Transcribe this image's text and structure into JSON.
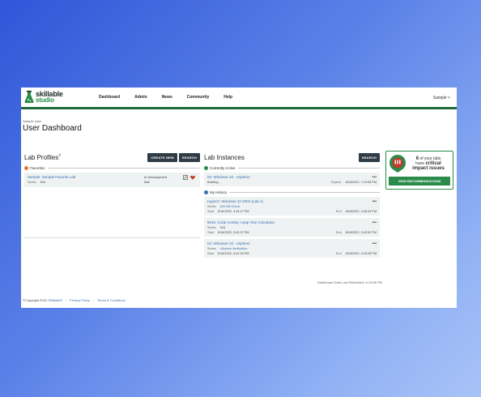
{
  "logo": {
    "line1": "skillable",
    "line2": "studio"
  },
  "nav": [
    "Dashboard",
    "Admin",
    "News",
    "Community",
    "Help"
  ],
  "user_menu": "Sample ˅",
  "header": {
    "sub": "Sample User",
    "title": "User Dashboard"
  },
  "lab_profiles": {
    "title": "Lab Profiles",
    "help": "?",
    "create_label": "CREATE NEW",
    "search_label": "SEARCH",
    "favorites_label": "Favorites",
    "favorites": [
      {
        "name": "Sample: Sample Favorite Lab",
        "series_key": "Series",
        "series_val": "N/A",
        "status": "In Development",
        "status2": "N/A"
      }
    ]
  },
  "lab_instances": {
    "title": "Lab Instances",
    "search_label": "SEARCH",
    "active_label": "Currently Active",
    "active": [
      {
        "name": "02: Windows 10 - vSphere",
        "status": "Building...",
        "expires_key": "Expires",
        "expires_val": "8/18/2022, 7:13:53 PM"
      }
    ],
    "history_label": "My History",
    "history": [
      {
        "name": "HyperV: Windows 10 2004 (Lab A)",
        "series_key": "Series",
        "series_val": "A/B Diff Check",
        "start_key": "Start",
        "start_val": "8/18/2022, 3:44:47 PM",
        "end_key": "End",
        "end_val": "8/18/2022, 4:45:44 PM"
      },
      {
        "name": "9042: Code Activity- Leap Year Calculator",
        "series_key": "Series",
        "series_val": "N/A",
        "start_key": "Start",
        "start_val": "8/18/2022, 3:42:37 PM",
        "end_key": "End",
        "end_val": "8/18/2022, 3:42:52 PM"
      },
      {
        "name": "02: Windows 10 - vSphere",
        "series_key": "Series",
        "series_val": "vSphere Verification",
        "start_key": "Start",
        "start_val": "8/18/2022, 3:41:30 PM",
        "end_key": "End",
        "end_val": "8/18/2022, 3:43:28 PM"
      }
    ],
    "more": "•••"
  },
  "recommendations": {
    "count_text": "6",
    "line_a": "of your labs",
    "line_b": "have",
    "critical": "critical",
    "line_c": "impact issues",
    "button": "VIEW RECOMMENDATIONS"
  },
  "refresh_text": "Dashboard Data Last Refreshed: 6:13:56 PM",
  "footer": {
    "copyright": "©Copyright 2022 ",
    "brand": "Skillable®",
    "privacy": "Privacy Policy",
    "terms": "Terms & Conditions"
  },
  "colors": {
    "brand_green": "#2a8b4a",
    "link_blue": "#3a6fb0",
    "button_dark": "#2f3b45",
    "heart": "#c0392b"
  }
}
